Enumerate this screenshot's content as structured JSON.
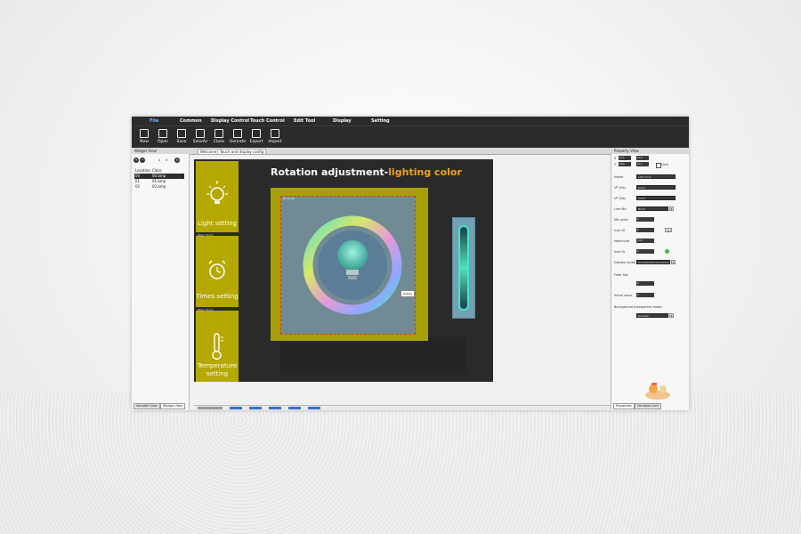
{
  "menu": [
    "File",
    "Common",
    "Display Control",
    "Touch Control",
    "Edit Tool",
    "Display",
    "Setting"
  ],
  "toolbar": [
    "New",
    "Open",
    "Save",
    "SaveAs",
    "Close",
    "Genrate",
    "Export",
    "Import"
  ],
  "left_panel": {
    "title": "Widget View",
    "columns": {
      "location": "Location",
      "class": "Class"
    },
    "rows": [
      {
        "location": "00",
        "class": "00.bmp",
        "selected": true
      },
      {
        "location": "01",
        "class": "01.bmp",
        "selected": false
      },
      {
        "location": "02",
        "class": "02.bmp",
        "selected": false
      }
    ],
    "tabs": [
      "Variable View",
      "Widget View"
    ]
  },
  "doc_tabs": [
    "Welcome",
    "Touch and display config"
  ],
  "canvas": {
    "title_main": "Rotation adjustment-",
    "title_highlight": "lighting color",
    "cards": [
      {
        "label": "Light setting",
        "caption": ""
      },
      {
        "label": "Times setting",
        "caption": "Basic Touch"
      },
      {
        "label": "Temperature setting",
        "caption": "Basic Touch"
      }
    ],
    "tag": "RP Circle",
    "tooltip": "Rotate"
  },
  "right_panel": {
    "title": "Property View",
    "top_values": {
      "x": "271",
      "y": "280",
      "w": "210",
      "h": "210"
    },
    "lock_label": "Lock",
    "props": [
      {
        "label": "Name",
        "value": "Left circle"
      },
      {
        "label": "VP (Hx)",
        "value": "0x00"
      },
      {
        "label": "VP (Dx)",
        "value": "0x00"
      },
      {
        "label": "Line Mo",
        "value": "Blank"
      },
      {
        "label": "Min start",
        "value": "0"
      },
      {
        "label": "Icon ID",
        "value": "0"
      },
      {
        "label": "Maximum",
        "value": "100"
      },
      {
        "label": "Icon ID",
        "value": "0"
      },
      {
        "label": "Display mode",
        "value": "Overlapping the display"
      },
      {
        "label": "Filter Set",
        "value": ""
      },
      {
        "label": "",
        "value": "0"
      },
      {
        "label": "Initial value",
        "value": "0"
      },
      {
        "label": "Background transparent mode",
        "value": ""
      },
      {
        "label": "",
        "value": "Overlap"
      }
    ],
    "tabs": [
      "Properties",
      "Variables Info"
    ]
  },
  "colors": {
    "accent_yellow": "#b5a800",
    "highlight": "#f0a21a",
    "dark_bar": "#2b2b2b"
  }
}
